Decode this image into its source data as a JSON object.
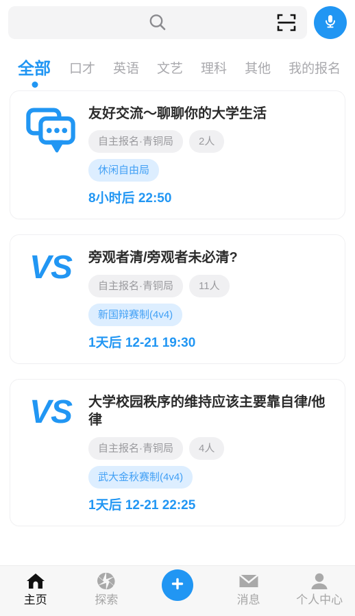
{
  "colors": {
    "accent": "#2196f3",
    "pill_gray_bg": "#f0f0f2",
    "pill_gray_text": "#9a9a9e",
    "pill_blue_bg": "#ddeeff",
    "pill_blue_text": "#42a0f5",
    "card_border": "#f0f0f2",
    "nav_bg": "#f7f7f7",
    "search_bg": "#f4f4f5",
    "title_text": "#2b2b2b",
    "tab_inactive": "#a9a9ad"
  },
  "search": {
    "value": "",
    "placeholder": "",
    "search_icon": "search-icon",
    "scan_icon": "scan-code-icon",
    "mic_icon": "microphone-icon"
  },
  "tabs": {
    "active_index": 0,
    "items": [
      {
        "label": "全部"
      },
      {
        "label": "口才"
      },
      {
        "label": "英语"
      },
      {
        "label": "文艺"
      },
      {
        "label": "理科"
      },
      {
        "label": "其他"
      },
      {
        "label": "我的报名"
      }
    ]
  },
  "cards": [
    {
      "icon": "chat-bubbles-icon",
      "icon_type": "chat",
      "title": "友好交流～聊聊你的大学生活",
      "pills": [
        {
          "text": "自主报名·青铜局",
          "style": "gray"
        },
        {
          "text": "2人",
          "style": "gray"
        }
      ],
      "tag": {
        "text": "休闲自由局",
        "style": "blue"
      },
      "time": "8小时后 22:50"
    },
    {
      "icon": "vs-icon",
      "icon_type": "vs",
      "icon_text": "VS",
      "title": "旁观者清/旁观者未必清?",
      "pills": [
        {
          "text": "自主报名·青铜局",
          "style": "gray"
        },
        {
          "text": "11人",
          "style": "gray"
        }
      ],
      "tag": {
        "text": "新国辩赛制(4v4)",
        "style": "blue"
      },
      "time": "1天后 12-21 19:30"
    },
    {
      "icon": "vs-icon",
      "icon_type": "vs",
      "icon_text": "VS",
      "title": "大学校园秩序的维持应该主要靠自律/他律",
      "pills": [
        {
          "text": "自主报名·青铜局",
          "style": "gray"
        },
        {
          "text": "4人",
          "style": "gray"
        }
      ],
      "tag": {
        "text": "武大金秋赛制(4v4)",
        "style": "blue"
      },
      "time": "1天后 12-21 22:25"
    }
  ],
  "bottom_nav": {
    "active_index": 0,
    "items": [
      {
        "label": "主页",
        "icon": "home-icon"
      },
      {
        "label": "探索",
        "icon": "aperture-icon"
      },
      {
        "label": "消息",
        "icon": "envelope-icon"
      },
      {
        "label": "个人中心",
        "icon": "person-icon"
      }
    ],
    "fab": {
      "label": "+",
      "icon": "plus-icon"
    }
  }
}
